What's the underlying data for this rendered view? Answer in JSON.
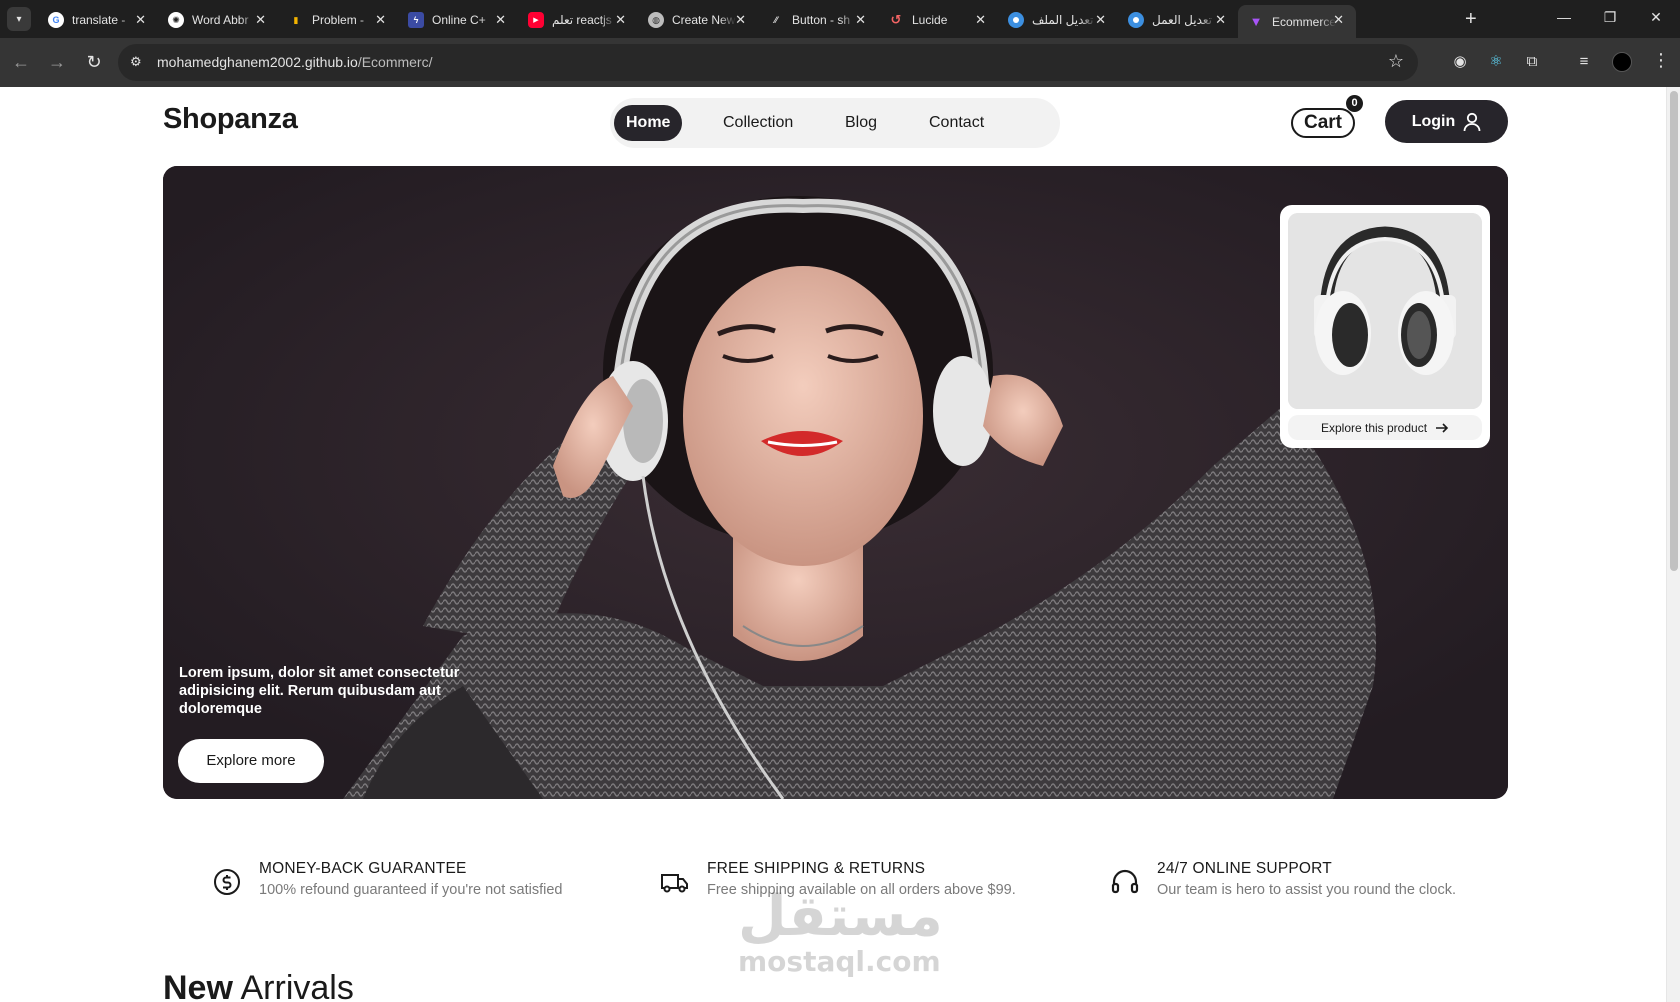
{
  "browser": {
    "tabs": [
      {
        "title": "translate -",
        "favicon": "google-icon",
        "color": "#ffffff"
      },
      {
        "title": "Word Abbr",
        "favicon": "chatgpt-icon",
        "color": "#ffffff"
      },
      {
        "title": "Problem -",
        "favicon": "bar-chart-icon",
        "color": "#f4b400"
      },
      {
        "title": "Online C+",
        "favicon": "bolt-icon",
        "color": "#3b4ba3"
      },
      {
        "title": "تعلم reactjs",
        "favicon": "youtube-icon",
        "color": "#ff0033"
      },
      {
        "title": "Create New",
        "favicon": "globe-icon",
        "color": "#bdbdbd"
      },
      {
        "title": "Button - sh",
        "favicon": "slash-icon",
        "color": "#dddddd"
      },
      {
        "title": "Lucide",
        "favicon": "lucide-icon",
        "color": "#f56565"
      },
      {
        "title": "تعديل الملف",
        "favicon": "circle-icon",
        "color": "#3c8fe0"
      },
      {
        "title": "تعديل العمل",
        "favicon": "circle-icon",
        "color": "#3c8fe0"
      },
      {
        "title": "Ecommerce",
        "favicon": "vite-icon",
        "color": "#a855f7",
        "active": true
      }
    ],
    "url_domain": "mohamedghanem2002.github.io",
    "url_path": "/Ecommerc/"
  },
  "header": {
    "logo": "Shopanza",
    "nav": [
      "Home",
      "Collection",
      "Blog",
      "Contact"
    ],
    "active_nav": "Home",
    "cart_label": "Cart",
    "cart_count": "0",
    "login_label": "Login"
  },
  "hero": {
    "text": "Lorem ipsum, dolor sit amet consectetur adipisicing elit. Rerum quibusdam aut doloremque",
    "cta": "Explore more",
    "product_card_link": "Explore this product"
  },
  "features": [
    {
      "icon": "dollar-circle-icon",
      "title": "MONEY-BACK GUARANTEE",
      "desc": "100% refound guaranteed if you're not satisfied"
    },
    {
      "icon": "truck-icon",
      "title": "FREE SHIPPING & RETURNS",
      "desc": "Free shipping available on all orders above $99."
    },
    {
      "icon": "headphones-icon",
      "title": "24/7 ONLINE SUPPORT",
      "desc": "Our team is hero to assist you round the clock."
    }
  ],
  "section": {
    "title_bold": "New",
    "title_rest": "Arrivals"
  },
  "watermark": {
    "arabic": "مستقل",
    "latin": "mostaql.com"
  },
  "colors": {
    "dark": "#27252b",
    "hero_bg": "#2a2228",
    "muted_text": "#7a7a7a"
  }
}
